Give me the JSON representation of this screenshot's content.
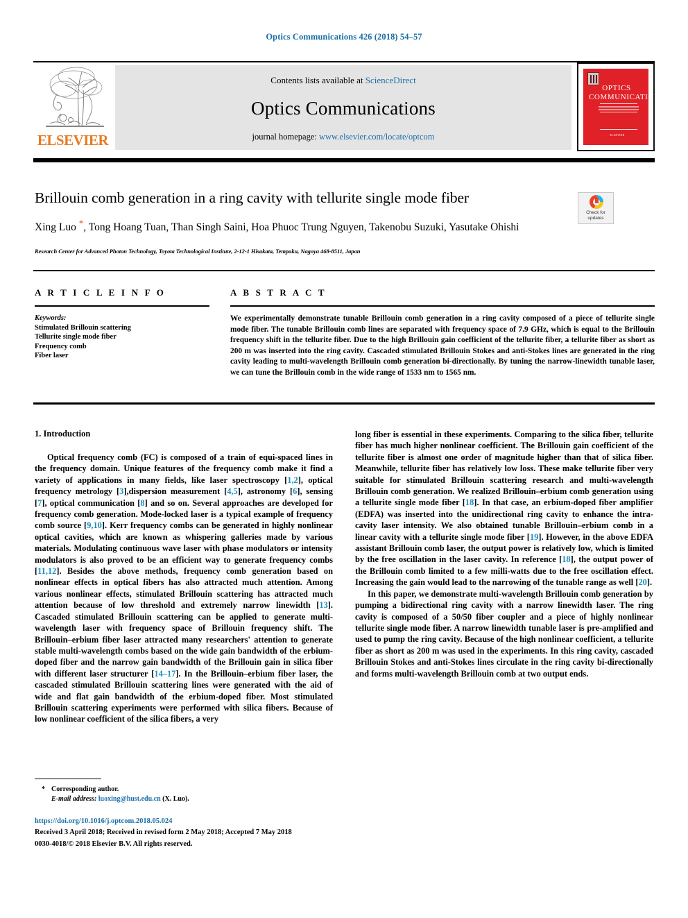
{
  "running_head": "Optics Communications 426 (2018) 54–57",
  "masthead": {
    "publisher_name": "ELSEVIER",
    "contents_prefix": "Contents lists available at ",
    "contents_link": "ScienceDirect",
    "journal_title": "Optics Communications",
    "homepage_prefix": "journal homepage: ",
    "homepage_link": "www.elsevier.com/locate/optcom",
    "cover": {
      "title_line1": "OPTICS",
      "title_line2": "COMMUNICATIONS",
      "footer": "ELSEVIER"
    }
  },
  "article": {
    "title": "Brillouin comb generation in a ring cavity with tellurite single mode fiber",
    "authors": "Xing Luo , Tong Hoang Tuan, Than Singh Saini, Hoa Phuoc Trung Nguyen, Takenobu Suzuki, Yasutake Ohishi",
    "author_star": "*",
    "affiliation": "Research Center for Advanced Photon Technology, Toyota Technological Institute, 2-12-1 Hisakata, Tempaku, Nagoya 468-8511, Japan",
    "crossmark": {
      "line1": "Check for",
      "line2": "updates"
    }
  },
  "info": {
    "article_info_heading": "A R T I C L E   I N F O",
    "abstract_heading": "A B S T R A C T",
    "keywords_label": "Keywords:",
    "keywords": [
      "Stimulated Brillouin scattering",
      "Tellurite single mode fiber",
      "Frequency comb",
      "Fiber laser"
    ],
    "abstract": "We experimentally demonstrate tunable Brillouin comb generation in a ring cavity composed of a piece of tellurite single mode fiber. The tunable Brillouin comb lines are separated with frequency space of 7.9 GHz, which is equal to the Brillouin frequency shift in the tellurite fiber. Due to the high Brillouin gain coefficient of the tellurite fiber, a tellurite fiber as short as 200 m was inserted into the ring cavity. Cascaded stimulated Brillouin Stokes and anti-Stokes lines are generated in the ring cavity leading to multi-wavelength Brillouin comb generation bi-directionally. By tuning the narrow-linewidth tunable laser, we can tune the Brillouin comb in the wide range of 1533 nm to 1565 nm."
  },
  "body": {
    "section_heading": "1.  Introduction",
    "left_paragraph_1_a": "Optical frequency comb (FC) is composed of a train of equi-spaced lines in the frequency domain. Unique features of the frequency comb make it find a variety of applications in many fields, like laser spectroscopy [",
    "left_paragraph_1_cite1": "1,2",
    "left_paragraph_1_b": "], optical frequency metrology [",
    "left_paragraph_1_cite2": "3",
    "left_paragraph_1_c": "],dispersion measurement [",
    "left_paragraph_1_cite3": "4,5",
    "left_paragraph_1_d": "], astronomy [",
    "left_paragraph_1_cite4": "6",
    "left_paragraph_1_e": "], sensing [",
    "left_paragraph_1_cite5": "7",
    "left_paragraph_1_f": "], optical communication [",
    "left_paragraph_1_cite6": "8",
    "left_paragraph_1_g": "] and so on. Several approaches are developed for frequency comb generation. Mode-locked laser is a typical example of frequency comb source [",
    "left_paragraph_1_cite7": "9,10",
    "left_paragraph_1_h": "]. Kerr frequency combs can be generated in highly nonlinear optical cavities, which are known as whispering galleries made by various materials. Modulating continuous wave laser with phase modulators or intensity modulators is also proved to be an efficient way to generate frequency combs [",
    "left_paragraph_1_cite8": "11,12",
    "left_paragraph_1_i": "]. Besides the above methods, frequency comb generation based on nonlinear effects in optical fibers has also attracted much attention. Among various nonlinear effects, stimulated Brillouin scattering has attracted much attention because of low threshold and extremely narrow linewidth [",
    "left_paragraph_1_cite9": "13",
    "left_paragraph_1_j": "]. Cascaded stimulated Brillouin scattering can be applied to generate multi-wavelength laser with frequency space of Brillouin frequency shift. The Brillouin–erbium fiber laser attracted many researchers' attention to generate stable multi-wavelength combs based on the wide gain bandwidth of the erbium-doped fiber and the narrow gain bandwidth of the Brillouin gain in silica fiber with different laser structurer [",
    "left_paragraph_1_cite10": "14–17",
    "left_paragraph_1_k": "]. In the Brillouin–erbium fiber laser, the cascaded stimulated Brillouin scattering lines were generated with the aid of wide and flat gain bandwidth of the erbium-doped fiber. Most stimulated Brillouin scattering experiments were performed with silica fibers. Because of low nonlinear coefficient of the silica fibers, a very",
    "right_paragraph_1_a": "long fiber is essential in these experiments. Comparing to the silica fiber, tellurite fiber has much higher nonlinear coefficient. The Brillouin gain coefficient of the tellurite fiber is almost one order of magnitude higher than that of silica fiber. Meanwhile, tellurite fiber has relatively low loss. These make tellurite fiber very suitable for stimulated Brillouin scattering research and multi-wavelength Brillouin comb generation. We realized Brillouin–erbium comb generation using a tellurite single mode fiber [",
    "right_paragraph_1_cite1": "18",
    "right_paragraph_1_b": "]. In that case, an erbium-doped fiber amplifier (EDFA) was inserted into the unidirectional ring cavity to enhance the intra-cavity laser intensity. We also obtained tunable Brillouin–erbium comb in a linear cavity with a tellurite single mode fiber [",
    "right_paragraph_1_cite2": "19",
    "right_paragraph_1_c": "]. However, in the above EDFA assistant Brillouin comb laser, the output power is relatively low, which is limited by the free oscillation in the laser cavity. In reference [",
    "right_paragraph_1_cite3": "18",
    "right_paragraph_1_d": "], the output power of the Brillouin comb limited to a few milli-watts due to the free oscillation effect. Increasing the gain would lead to the narrowing of the tunable range as well [",
    "right_paragraph_1_cite4": "20",
    "right_paragraph_1_e": "].",
    "right_paragraph_2": "In this paper, we demonstrate multi-wavelength Brillouin comb generation by pumping a bidirectional ring cavity with a narrow linewidth laser. The ring cavity is composed of a 50/50 fiber coupler and a piece of highly nonlinear tellurite single mode fiber. A narrow linewidth tunable laser is pre-amplified and used to pump the ring cavity. Because of the high nonlinear coefficient, a tellurite fiber as short as 200 m was used in the experiments. In this ring cavity, cascaded Brillouin Stokes and anti-Stokes lines circulate in the ring cavity bi-directionally and forms multi-wavelength Brillouin comb at two output ends."
  },
  "footer": {
    "star": "*",
    "corresponding_author": "Corresponding author.",
    "email_label": "E-mail address:",
    "email": "luoxing@hust.edu.cn",
    "email_suffix": "(X. Luo).",
    "doi": "https://doi.org/10.1016/j.optcom.2018.05.024",
    "received": "Received 3 April 2018; Received in revised form 2 May 2018; Accepted 7 May 2018",
    "copyright": "0030-4018/© 2018 Elsevier B.V. All rights reserved."
  },
  "colors": {
    "link_blue": "#1a6ea8",
    "cite_blue": "#1a8fc1",
    "elsevier_orange": "#e87a22",
    "cover_red": "#e02128",
    "star_red": "#e8432a"
  }
}
